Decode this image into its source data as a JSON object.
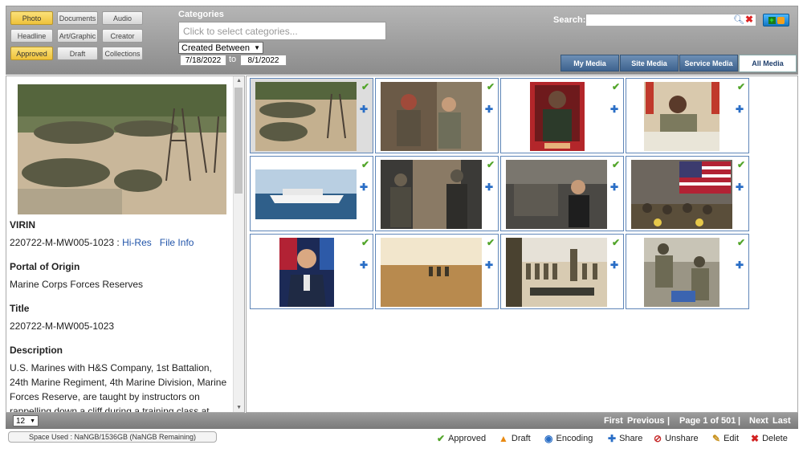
{
  "filters": {
    "photo": "Photo",
    "documents": "Documents",
    "audio": "Audio",
    "headline": "Headline",
    "art_graphic": "Art/Graphic",
    "creator": "Creator",
    "approved": "Approved",
    "draft": "Draft",
    "collections": "Collections"
  },
  "categories": {
    "label": "Categories",
    "placeholder": "Click to select categories...",
    "date_mode": "Created Between",
    "date_from": "7/18/2022",
    "to_label": "to",
    "date_to": "8/1/2022"
  },
  "search": {
    "label": "Search:",
    "value": ""
  },
  "tabs": [
    {
      "label": "My Media"
    },
    {
      "label": "Site Media"
    },
    {
      "label": "Service Media"
    },
    {
      "label": "All Media"
    }
  ],
  "details": {
    "virin_heading": "VIRIN",
    "virin": "220722-M-MW005-1023 :",
    "hires_link": "Hi-Res",
    "fileinfo_link": "File Info",
    "origin_heading": "Portal of Origin",
    "origin": "Marine Corps Forces Reserves",
    "title_heading": "Title",
    "title": "220722-M-MW005-1023",
    "desc_heading": "Description",
    "description": "U.S. Marines with H&S Company, 1st Battalion, 24th Marine Regiment, 4th Marine Division, Marine Forces Reserve, are taught by instructors on rappelling down a cliff during a training class at"
  },
  "thumbnails": [
    {
      "scene": "troops-seated-training"
    },
    {
      "scene": "soldiers-talking"
    },
    {
      "scene": "marine-portrait"
    },
    {
      "scene": "officer-signing"
    },
    {
      "scene": "hospital-ship"
    },
    {
      "scene": "soldier-gear"
    },
    {
      "scene": "aircraft-crew"
    },
    {
      "scene": "audience-flag"
    },
    {
      "scene": "general-portrait"
    },
    {
      "scene": "desert-patrol"
    },
    {
      "scene": "formation-field"
    },
    {
      "scene": "casualty-drill"
    }
  ],
  "pager": {
    "page_size": "12",
    "first": "First",
    "previous": "Previous",
    "sep1": "|",
    "page_info": "Page 1 of 501",
    "sep2": "|",
    "next": "Next",
    "last": "Last"
  },
  "status": {
    "space_used": "Space Used : NaNGB/1536GB (NaNGB Remaining)",
    "approved": "Approved",
    "draft": "Draft",
    "encoding": "Encoding",
    "share": "Share",
    "unshare": "Unshare",
    "edit": "Edit",
    "delete": "Delete"
  },
  "colors": {
    "accent_yellow": "#efc23a",
    "tab_blue": "#3e638f",
    "check_green": "#52a52a",
    "plus_blue": "#2a6ec6",
    "delete_red": "#d22222"
  }
}
